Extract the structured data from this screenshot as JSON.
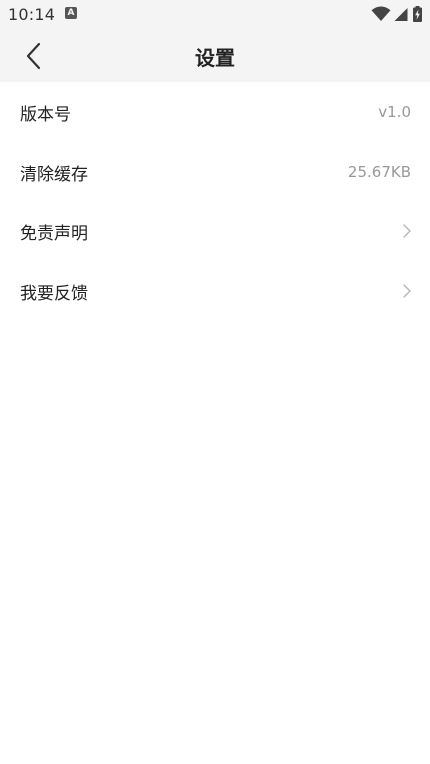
{
  "status_bar": {
    "time": "10:14",
    "input_indicator": "A",
    "icons": [
      "wifi-icon",
      "cellular-signal-icon",
      "battery-charging-icon"
    ]
  },
  "nav": {
    "title": "设置",
    "back_icon": "chevron-left-icon"
  },
  "settings": {
    "items": [
      {
        "label": "版本号",
        "value": "v1.0"
      },
      {
        "label": "清除缓存",
        "value": "25.67KB"
      },
      {
        "label": "免责声明",
        "icon": "chevron-right-icon"
      },
      {
        "label": "我要反馈",
        "icon": "chevron-right-icon"
      }
    ]
  },
  "colors": {
    "header_bg": "#f4f4f4",
    "page_bg": "#ffffff",
    "text_primary": "#222222",
    "text_secondary": "#999999",
    "chevron": "#b5b5b5"
  }
}
